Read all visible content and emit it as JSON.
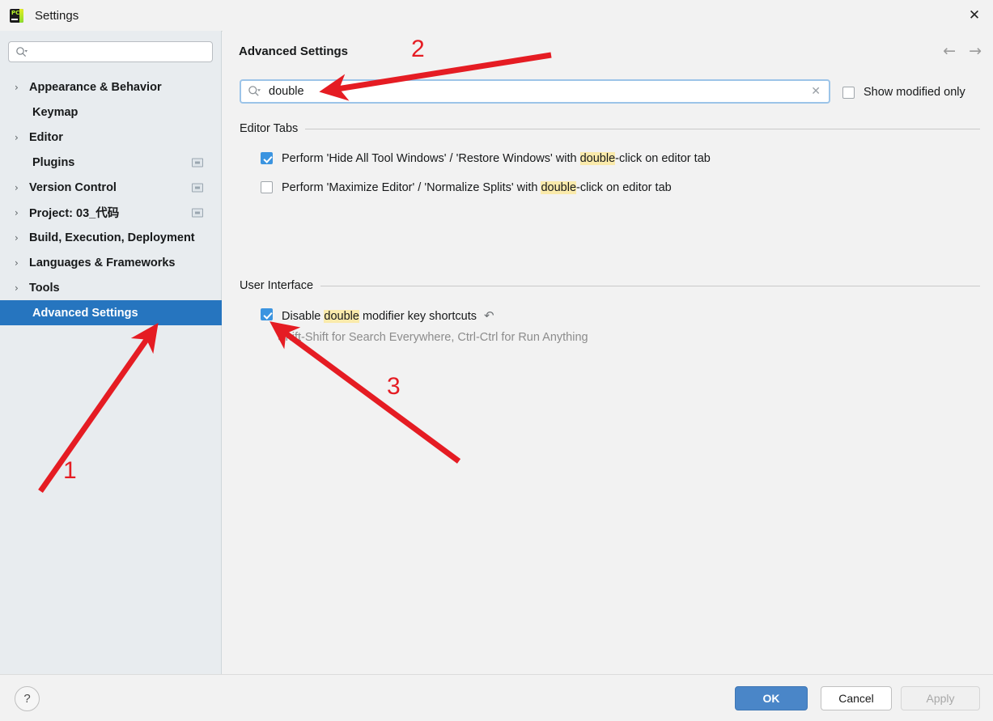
{
  "window": {
    "title": "Settings",
    "app_icon": "pycharm-icon",
    "close_icon": "close-icon"
  },
  "sidebar": {
    "search": {
      "placeholder": "",
      "value": "",
      "icon": "search-icon"
    },
    "items": [
      {
        "label": "Appearance & Behavior",
        "expandable": true,
        "badge": false,
        "selected": false
      },
      {
        "label": "Keymap",
        "expandable": false,
        "badge": false,
        "selected": false
      },
      {
        "label": "Editor",
        "expandable": true,
        "badge": false,
        "selected": false
      },
      {
        "label": "Plugins",
        "expandable": false,
        "badge": true,
        "selected": false
      },
      {
        "label": "Version Control",
        "expandable": true,
        "badge": true,
        "selected": false
      },
      {
        "label": "Project: 03_代码",
        "expandable": true,
        "badge": true,
        "selected": false
      },
      {
        "label": "Build, Execution, Deployment",
        "expandable": true,
        "badge": false,
        "selected": false
      },
      {
        "label": "Languages & Frameworks",
        "expandable": true,
        "badge": false,
        "selected": false
      },
      {
        "label": "Tools",
        "expandable": true,
        "badge": false,
        "selected": false
      },
      {
        "label": "Advanced Settings",
        "expandable": false,
        "badge": false,
        "selected": true
      }
    ]
  },
  "main": {
    "title": "Advanced Settings",
    "nav": {
      "back_icon": "arrow-left-icon",
      "forward_icon": "arrow-right-icon"
    },
    "search": {
      "value": "double",
      "icon": "search-icon",
      "clear_icon": "close-icon"
    },
    "show_modified_only": {
      "label": "Show modified only",
      "checked": false
    },
    "sections": [
      {
        "title": "Editor Tabs",
        "options": [
          {
            "checked": true,
            "pre": "Perform 'Hide All Tool Windows' / 'Restore Windows' with ",
            "highlight": "double",
            "post": "-click on editor tab"
          },
          {
            "checked": false,
            "pre": "Perform 'Maximize Editor' / 'Normalize Splits' with ",
            "highlight": "double",
            "post": "-click on editor tab"
          }
        ]
      },
      {
        "title": "User Interface",
        "options": [
          {
            "checked": true,
            "pre": "Disable ",
            "highlight": "double",
            "post": " modifier key shortcuts",
            "revert_icon": "revert-icon",
            "note": "Shift-Shift for Search Everywhere, Ctrl-Ctrl for Run Anything"
          }
        ]
      }
    ]
  },
  "footer": {
    "help_label": "?",
    "ok_label": "OK",
    "cancel_label": "Cancel",
    "apply_label": "Apply"
  },
  "annotations": {
    "color": "#e51c23",
    "marks": [
      {
        "number": "1",
        "target": "sidebar-item-advanced-settings"
      },
      {
        "number": "2",
        "target": "advanced-settings-search-input"
      },
      {
        "number": "3",
        "target": "disable-double-modifier-checkbox"
      }
    ]
  },
  "colors": {
    "selection_blue": "#2675bf",
    "highlight_yellow": "#faeaab",
    "accent_button": "#4a86c8",
    "sidebar_bg": "#e8ecef",
    "panel_bg": "#f2f2f2"
  }
}
